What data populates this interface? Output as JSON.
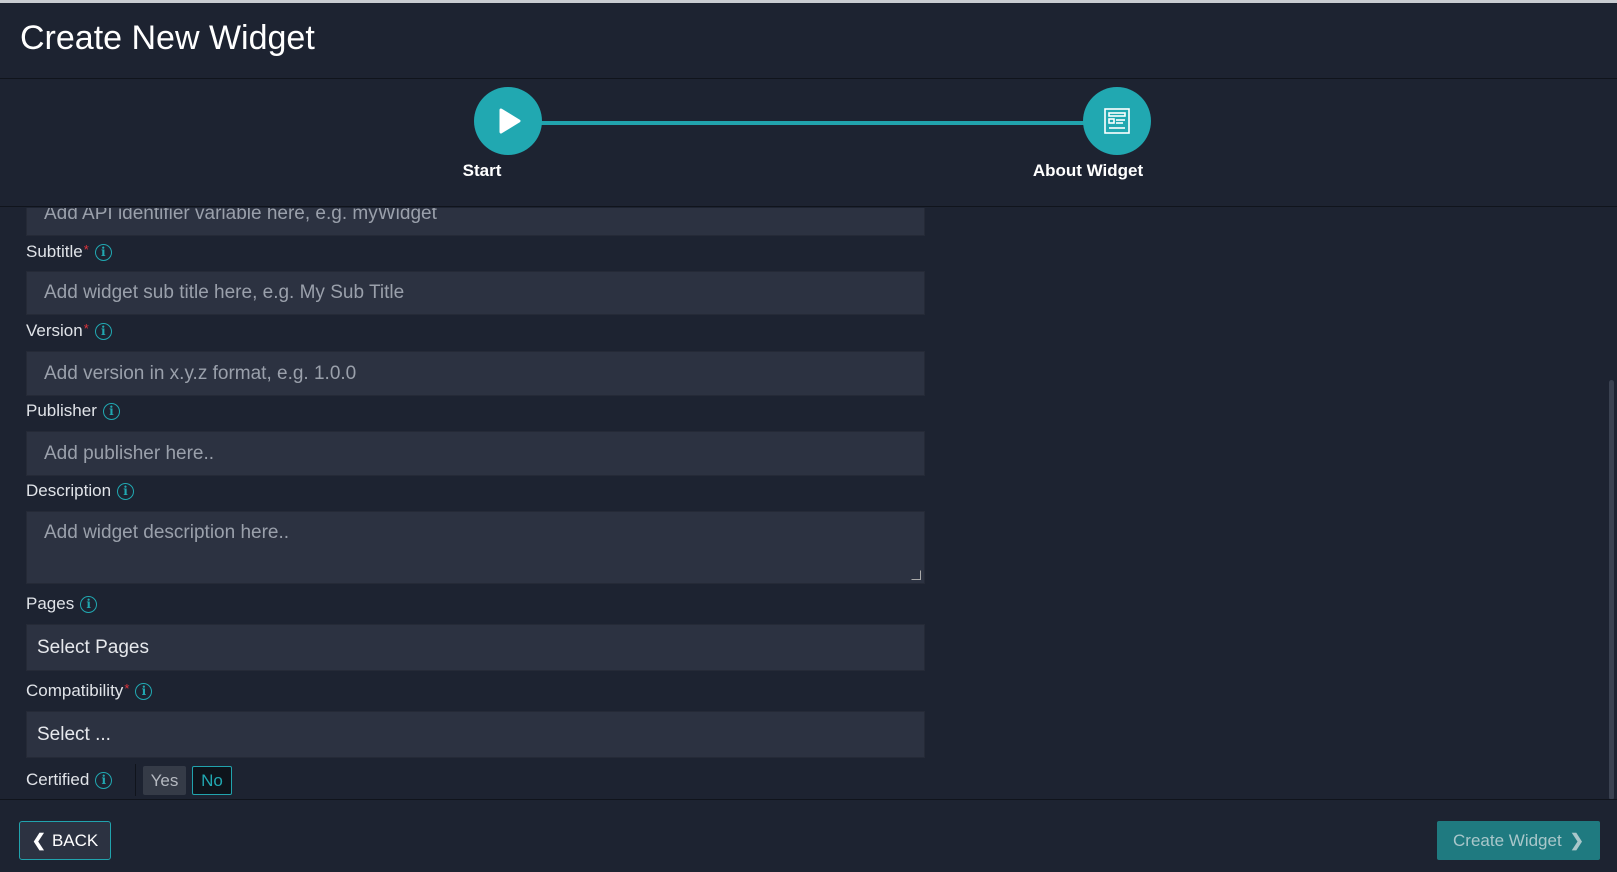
{
  "header": {
    "title": "Create New Widget"
  },
  "stepper": {
    "steps": [
      {
        "label": "Start",
        "icon": "play-icon"
      },
      {
        "label": "About Widget",
        "icon": "widget-form-icon"
      }
    ]
  },
  "form": {
    "api_identifier": {
      "placeholder": "Add API identifier variable here, e.g. myWidget"
    },
    "subtitle": {
      "label": "Subtitle",
      "required": "*",
      "placeholder": "Add widget sub title here, e.g. My Sub Title"
    },
    "version": {
      "label": "Version",
      "required": "*",
      "placeholder": "Add version in x.y.z format, e.g. 1.0.0"
    },
    "publisher": {
      "label": "Publisher",
      "placeholder": "Add publisher here.."
    },
    "description": {
      "label": "Description",
      "placeholder": "Add widget description here.."
    },
    "pages": {
      "label": "Pages",
      "value": "Select Pages"
    },
    "compatibility": {
      "label": "Compatibility",
      "required": "*",
      "value": "Select ..."
    },
    "certified": {
      "label": "Certified",
      "yes": "Yes",
      "no": "No",
      "selected": "No"
    },
    "info_glyph": "i"
  },
  "footer": {
    "back": "BACK",
    "create": "Create Widget"
  },
  "colors": {
    "accent": "#21a8b1",
    "background": "#1d2331",
    "input": "#2c3241"
  }
}
